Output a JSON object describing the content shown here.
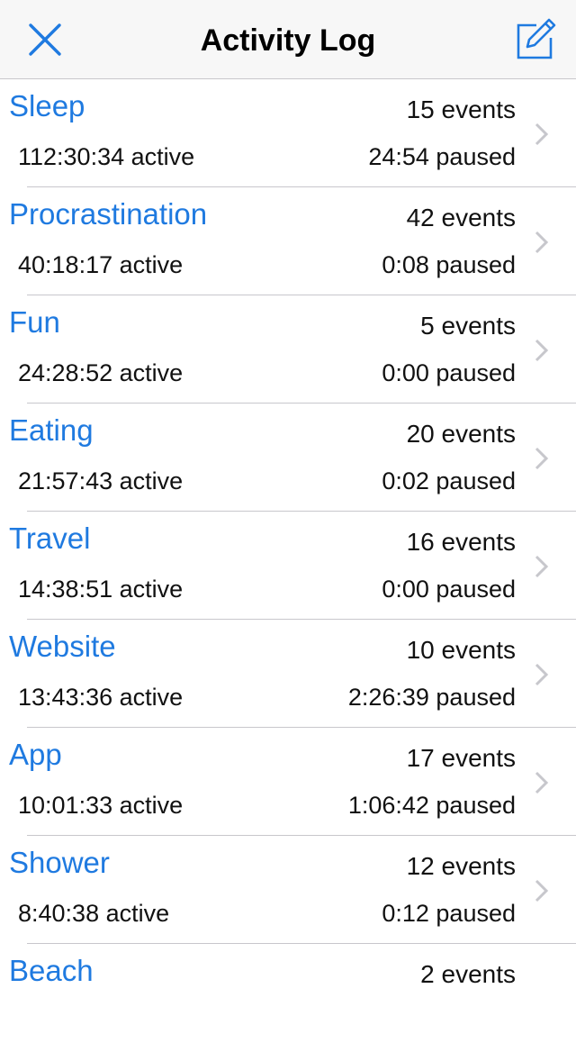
{
  "header": {
    "title": "Activity Log",
    "close_icon": "close-icon",
    "compose_icon": "compose-icon"
  },
  "colors": {
    "accent": "#1f7ae0",
    "nav_background": "#f7f7f7",
    "separator": "#c8c7cc",
    "chevron": "#c7c7cc"
  },
  "activities": [
    {
      "name": "Sleep",
      "events": "15 events",
      "active": "112:30:34 active",
      "paused": "24:54 paused"
    },
    {
      "name": "Procrastination",
      "events": "42 events",
      "active": "40:18:17 active",
      "paused": "0:08 paused"
    },
    {
      "name": "Fun",
      "events": "5 events",
      "active": "24:28:52 active",
      "paused": "0:00 paused"
    },
    {
      "name": "Eating",
      "events": "20 events",
      "active": "21:57:43 active",
      "paused": "0:02 paused"
    },
    {
      "name": "Travel",
      "events": "16 events",
      "active": "14:38:51 active",
      "paused": "0:00 paused"
    },
    {
      "name": "Website",
      "events": "10 events",
      "active": "13:43:36 active",
      "paused": "2:26:39 paused"
    },
    {
      "name": "App",
      "events": "17 events",
      "active": "10:01:33 active",
      "paused": "1:06:42 paused"
    },
    {
      "name": "Shower",
      "events": "12 events",
      "active": "8:40:38 active",
      "paused": "0:12 paused"
    },
    {
      "name": "Beach",
      "events": "2 events",
      "active": "",
      "paused": ""
    }
  ]
}
